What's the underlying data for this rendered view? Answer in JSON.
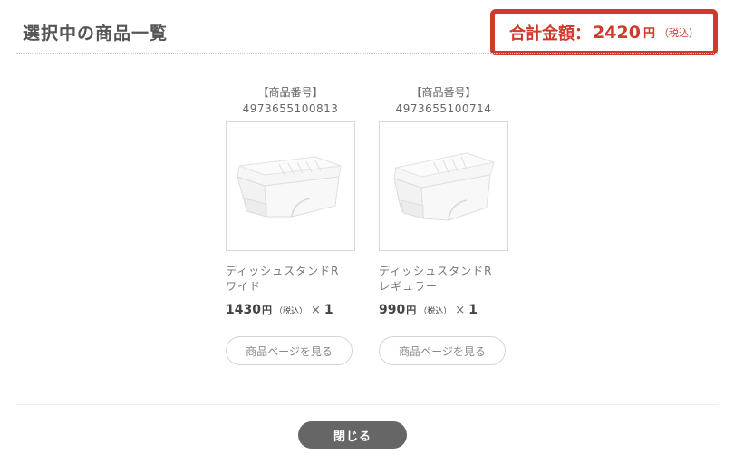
{
  "header": {
    "title": "選択中の商品一覧"
  },
  "total": {
    "label": "合計金額：",
    "amount": "2420",
    "currency": "円",
    "tax_note": "（税込）",
    "color": "#cf3a2b"
  },
  "products": [
    {
      "number_label": "【商品番号】",
      "number": "4973655100813",
      "name_line1": "ディッシュスタンドR",
      "name_line2": "ワイド",
      "price": "1430",
      "currency": "円",
      "tax_note": "（税込）",
      "qty_sign": "×",
      "qty": "1",
      "page_button": "商品ページを見る",
      "image_icon": "dish-stand-icon"
    },
    {
      "number_label": "【商品番号】",
      "number": "4973655100714",
      "name_line1": "ディッシュスタンドR",
      "name_line2": "レギュラー",
      "price": "990",
      "currency": "円",
      "tax_note": "（税込）",
      "qty_sign": "×",
      "qty": "1",
      "page_button": "商品ページを見る",
      "image_icon": "dish-stand-icon"
    }
  ],
  "footer": {
    "close_label": "閉じる"
  }
}
